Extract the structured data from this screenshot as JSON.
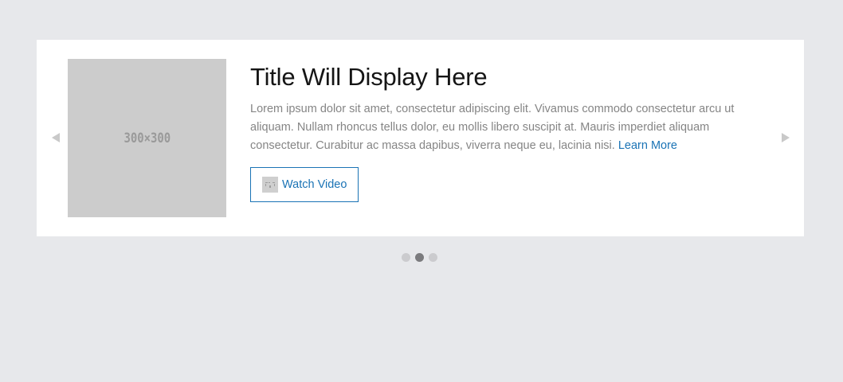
{
  "colors": {
    "page_background": "#e7e8eb",
    "card_background": "#ffffff",
    "accent": "#1a73b5",
    "title": "#151515",
    "body_text": "#858585",
    "placeholder": "#cccccc",
    "dot_inactive": "#cbcbce",
    "dot_active": "#7b7b7e"
  },
  "carousel": {
    "prev_icon": "triangle-left-icon",
    "next_icon": "triangle-right-icon",
    "slide": {
      "image_label": "300×300",
      "title": "Title Will Display Here",
      "body": "Lorem ipsum dolor sit amet, consectetur adipiscing elit. Vivamus commodo consectetur arcu ut aliquam. Nullam rhoncus tellus dolor, eu mollis libero suscipit at. Mauris imperdiet aliquam consectetur. Curabitur ac massa dapibus, viverra neque eu, lacinia nisi.",
      "learn_more": "Learn More",
      "button": {
        "label": "Watch Video",
        "icon": "broken-image-icon"
      }
    },
    "pagination": {
      "total": 3,
      "active_index": 1
    }
  }
}
